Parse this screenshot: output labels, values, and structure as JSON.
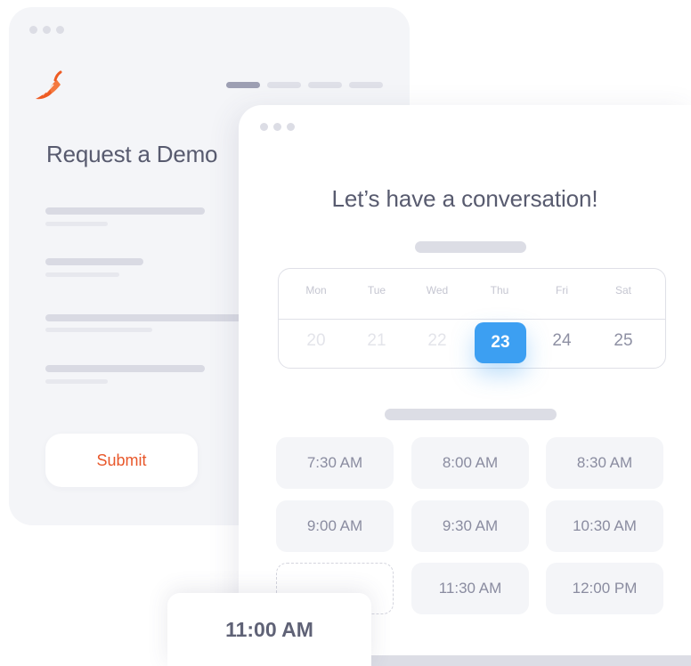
{
  "back_form": {
    "title": "Request a Demo",
    "submit_label": "Submit",
    "stepper": [
      "active",
      "inactive",
      "inactive",
      "inactive"
    ],
    "logo_icon": "pepper-logo-icon",
    "accent_color": "#e8582b"
  },
  "scheduler": {
    "title": "Let’s have a conversation!",
    "days": [
      {
        "name": "Mon",
        "date": "20",
        "available": false
      },
      {
        "name": "Tue",
        "date": "21",
        "available": false
      },
      {
        "name": "Wed",
        "date": "22",
        "available": false
      },
      {
        "name": "Thu",
        "date": "23",
        "available": true,
        "selected": true
      },
      {
        "name": "Fri",
        "date": "24",
        "available": true
      },
      {
        "name": "Sat",
        "date": "25",
        "available": true
      }
    ],
    "selected_date": "23",
    "selected_color": "#3c9ff2",
    "time_slots": [
      "7:30 AM",
      "8:00 AM",
      "8:30 AM",
      "9:00 AM",
      "9:30 AM",
      "10:30 AM",
      "",
      "11:30 AM",
      "12:00 PM"
    ],
    "dragged_slot": "11:00 AM"
  }
}
